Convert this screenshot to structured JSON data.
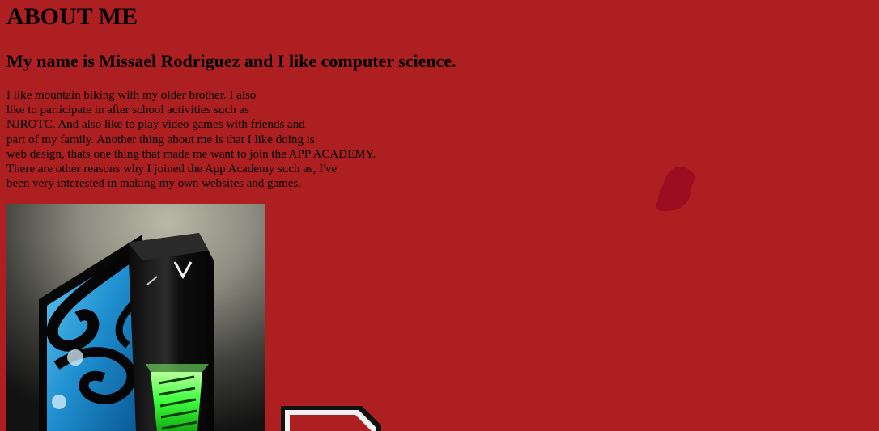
{
  "header": {
    "title": "ABOUT ME",
    "subtitle": "My name is Missael Rodriguez and I like computer science."
  },
  "bio": {
    "lines": [
      "I like mountain biking with my older brother. I also",
      "like to participate in after school activities such as",
      "NJROTC. And also like to play video games with friends and",
      "part of my family. Another thing about me is that I like doing is",
      "web design, thats one thing that made me want to join the APP ACADEMY.",
      "There are other reasons why I joined the App Academy such as, I've",
      "been very interested in making my own websites and games."
    ]
  },
  "images": {
    "computer": "gaming-pc-tower-image",
    "decoration": "red-blob-image",
    "sign": "red-sign-image"
  },
  "colors": {
    "background": "#ae1f21",
    "text": "#000000",
    "blob": "#9c0d22",
    "pc_glow": "#3cff3c",
    "pc_panel": "#2aa8e6"
  }
}
